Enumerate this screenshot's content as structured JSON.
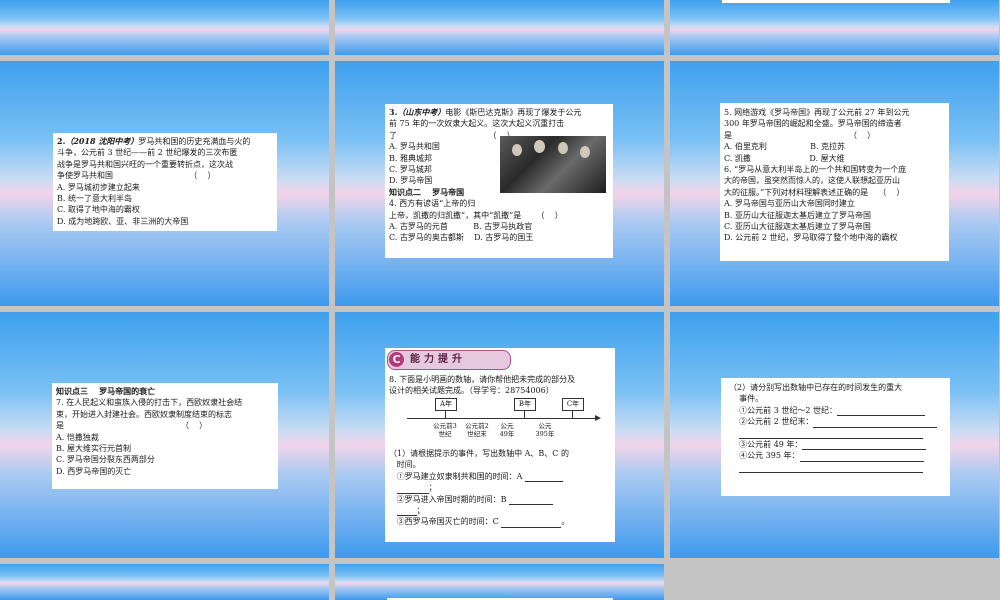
{
  "colors": {
    "page_bg": "#c4c4c4",
    "card_bg": "#ffffff",
    "accent": "#b43a7c",
    "slide_top": "#3fa0ee",
    "slide_mid": "#f2d4ea"
  },
  "slide2": {
    "q2_lines": [
      "战争是罗马共和国兴旺的一个重要转折点，这次战",
      "争使罗马共和国                              （    ）",
      "A. 罗马城初步建立起来",
      "B. 统一了意大利半岛",
      "C. 取得了地中海的霸权",
      "D. 成为地跨欧、亚、非三洲的大帝国"
    ]
  },
  "slide3": {
    "q3_number": "3.",
    "q3_source": "（山东中考）",
    "q3_lines": [
      "电影《斯巴达克斯》再现了爆发于公元",
      "前 75 年的一次奴隶大起义。这次大起义沉重打击",
      "了                                    （    ）"
    ],
    "q3_options": [
      "A. 罗马共和国",
      "B. 雅典城邦",
      "C. 罗马城邦",
      "D. 罗马帝国"
    ],
    "photo_icon": "gladiators-photo",
    "section_heading": "知识点二    罗马帝国",
    "q4_lines": [
      "4. 西方有谚语“上帝的归",
      "上帝，凯撒的归凯撒”，其中“凯撒”是      （    ）",
      "A. 古罗马的元首          B. 古罗马执政官",
      "C. 古罗马的奥古都斯    D. 古罗马的国王"
    ]
  },
  "slide4": {
    "lines": [
      "5. 网络游戏《罗马帝国》再现了公元前 27 年到公元",
      "300 年罗马帝国的崛起和全盛。罗马帝国的缔造者",
      "是                                              （    ）",
      "A. 伯里克利                 B. 克拉苏",
      "C. 凯撒                       D. 屋大维",
      "6. “罗马从意大利半岛上的一个共和国转变为一个庞",
      "大的帝国，虽突然而惊人的，这使人联想起亚历山",
      "大的征服。”下列对材料理解表述正确的是    （    ）",
      "A. 罗马帝国与亚历山大帝国同时建立",
      "B. 亚历山大征服迦太基后建立了罗马帝国",
      "C. 亚历山大征服迦太基后建立了罗马帝国",
      "D. 公元前 2 世纪，罗马取得了整个地中海的霸权"
    ]
  },
  "slide5": {
    "section_heading": "知识点三    罗马帝国的衰亡",
    "lines": [
      "7. 在人民起义和蛮族入侵的打击下，西欧奴隶社会结",
      "束，开始进入封建社会。西欧奴隶制度结束的标志",
      "是                                              （    ）",
      "A. 恺撒独裁",
      "B. 屋大维实行元首制",
      "C. 罗马帝国分裂东西两部分",
      "D. 西罗马帝国的灭亡"
    ]
  },
  "slide6": {
    "banner_letter": "C",
    "banner_title": "能力提升",
    "q8_lines": [
      "8. 下面是小明画的数轴，请你帮他把未完成的部分及",
      "设计的相关试题完成。（导学号：28754006）"
    ],
    "axis_boxes": [
      "A年",
      "B年",
      "C年"
    ],
    "axis_ticks": [
      {
        "top": "公元前3",
        "bottom": "世纪"
      },
      {
        "top": "公元前2",
        "bottom": "世纪末"
      },
      {
        "top": "公元",
        "bottom": "49年"
      },
      {
        "top": "公元",
        "bottom": "395年"
      }
    ],
    "sub1_lines": [
      "（1）请根据提示的事件，写出数轴中 A、B、C 的",
      "时间。"
    ],
    "sub1_items": [
      "①罗马建立奴隶制共和国的时间：A",
      "②罗马进入帝国时期的时间：B",
      "③西罗马帝国灭亡的时间：C"
    ],
    "suffix_comma": "；",
    "suffix_period": "。"
  },
  "slide9": {
    "lines": [
      "（2）请分别写出数轴中已存在的时间发生的重大",
      "事件。"
    ],
    "items": [
      "①公元前 3 世纪～2 世纪：",
      "②公元前 2 世纪末：",
      "③公元前 49 年：",
      "④公元 395 年："
    ]
  }
}
